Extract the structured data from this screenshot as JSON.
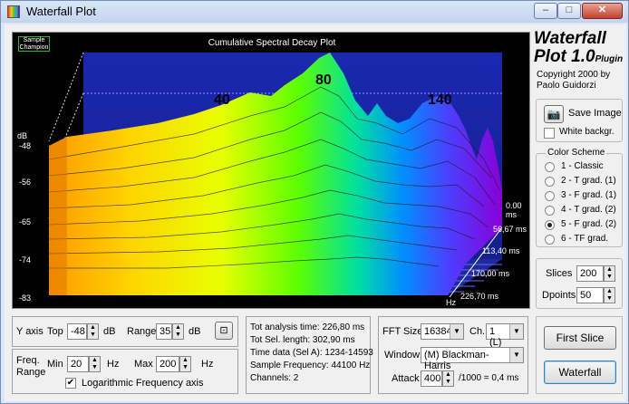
{
  "window": {
    "title": "Waterfall Plot",
    "minimize": "–",
    "maximize": "□",
    "close": "✕"
  },
  "plot": {
    "brand_line1": "Sample",
    "brand_line2": "Champion",
    "title": "Cumulative Spectral Decay Plot",
    "db_unit": "dB",
    "db_ticks": [
      "-48",
      "-56",
      "-65",
      "-74",
      "-83"
    ],
    "time_ticks": [
      "0.00 ms",
      "56,67 ms",
      "113,40 ms",
      "170,00 ms",
      "226,70 ms"
    ],
    "freq_unit": "Hz",
    "peak_labels": [
      "40",
      "80",
      "140"
    ]
  },
  "header": {
    "title_main": "Waterfall",
    "title_line2": "Plot 1.0",
    "title_suffix": "Plugin",
    "copyright": "Copyright 2000 by",
    "author": "Paolo Guidorzi"
  },
  "save": {
    "label": "Save Image",
    "white_bg_label": "White backgr.",
    "white_bg_checked": false
  },
  "color_scheme": {
    "legend": "Color Scheme",
    "options": [
      "1 - Classic",
      "2 - T grad. (1)",
      "3 - F grad. (1)",
      "4 - T grad. (2)",
      "5 - F grad. (2)",
      "6 - TF grad."
    ],
    "selected_index": 4
  },
  "slices": {
    "label": "Slices",
    "value": "200"
  },
  "dpoints": {
    "label": "Dpoints",
    "value": "50"
  },
  "yaxis": {
    "label": "Y axis",
    "top_label": "Top",
    "top_value": "-48",
    "top_unit": "dB",
    "range_label": "Range",
    "range_value": "35",
    "range_unit": "dB"
  },
  "freq": {
    "label_line1": "Freq.",
    "label_line2": "Range",
    "min_label": "Min",
    "min_value": "20",
    "min_unit": "Hz",
    "max_label": "Max",
    "max_value": "200",
    "max_unit": "Hz",
    "log_label": "Logarithmic Frequency axis",
    "log_checked": true
  },
  "info": {
    "line1": "Tot analysis time: 226,80 ms",
    "line2": "Tot Sel. length: 302,90 ms",
    "line3": "Time data (Sel A): 1234-14593",
    "line4": "Sample Frequency: 44100 Hz",
    "line5": "Channels: 2"
  },
  "fft": {
    "size_label": "FFT Size",
    "size_value": "16384",
    "ch_label": "Ch.",
    "ch_value": "1 (L)",
    "window_label": "Window",
    "window_value": "(M) Blackman-Harris",
    "attack_label": "Attack",
    "attack_value": "400",
    "attack_suffix": "/1000 = 0,4 ms"
  },
  "actions": {
    "first_slice": "First Slice",
    "waterfall": "Waterfall"
  }
}
